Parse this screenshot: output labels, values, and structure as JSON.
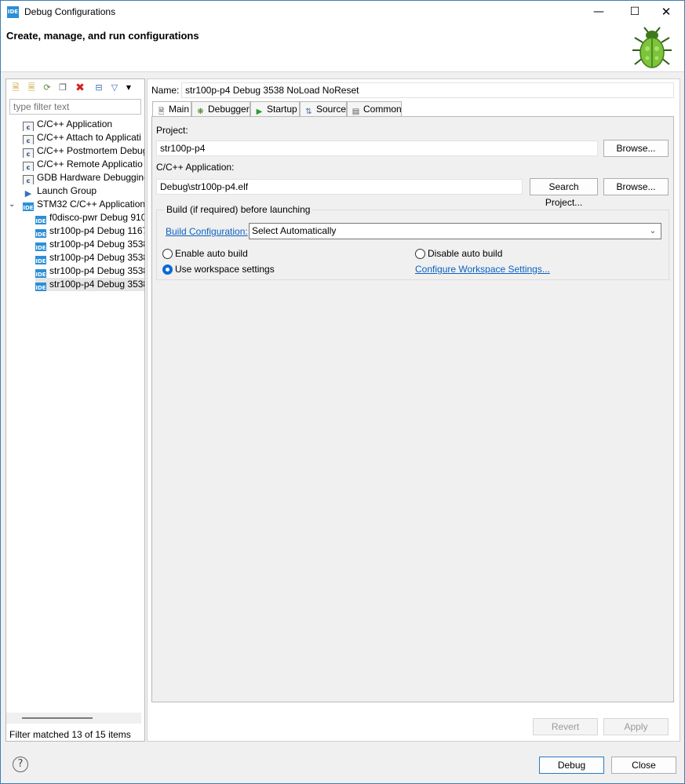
{
  "window": {
    "app_icon": "IDE",
    "title": "Debug Configurations",
    "minimize": "—",
    "maximize": "☐",
    "close": "✕"
  },
  "header": {
    "title": "Create, manage, and run configurations",
    "logo": "bug-icon"
  },
  "toolbar": {
    "icons": [
      "new-configuration-icon",
      "new-prototype-icon",
      "export-icon",
      "duplicate-icon",
      "delete-icon",
      "collapse-all-icon",
      "filter-icon",
      "dropdown-icon"
    ]
  },
  "filter": {
    "placeholder": "type filter text",
    "status": "Filter matched 13 of 15 items"
  },
  "tree": {
    "items": [
      {
        "label": "C/C++ Application",
        "icon": "c-icon"
      },
      {
        "label": "C/C++ Attach to Applicati",
        "icon": "c-icon"
      },
      {
        "label": "C/C++ Postmortem Debug",
        "icon": "c-icon"
      },
      {
        "label": "C/C++ Remote Applicatio",
        "icon": "c-icon"
      },
      {
        "label": "GDB Hardware Debugging",
        "icon": "c-icon"
      },
      {
        "label": "Launch Group",
        "icon": "launch-group-icon"
      },
      {
        "label": "STM32 C/C++ Application",
        "icon": "ide-icon",
        "expanded": true
      },
      {
        "label": "f0disco-pwr Debug 910",
        "icon": "ide-icon"
      },
      {
        "label": "str100p-p4 Debug 1167",
        "icon": "ide-icon"
      },
      {
        "label": "str100p-p4 Debug 3538",
        "icon": "ide-icon"
      },
      {
        "label": "str100p-p4 Debug 3538",
        "icon": "ide-icon"
      },
      {
        "label": "str100p-p4 Debug 3538",
        "icon": "ide-icon"
      },
      {
        "label": "str100p-p4 Debug 3538",
        "icon": "ide-icon",
        "selected": true
      }
    ],
    "icon_text": "IDE",
    "c_icon_text": "c"
  },
  "config": {
    "name_label": "Name:",
    "name_value": "str100p-p4 Debug 3538 NoLoad NoReset",
    "tabs": [
      {
        "label": "Main",
        "icon": "main-tab-icon"
      },
      {
        "label": "Debugger",
        "icon": "debugger-tab-icon"
      },
      {
        "label": "Startup",
        "icon": "startup-tab-icon"
      },
      {
        "label": "Source",
        "icon": "source-tab-icon"
      },
      {
        "label": "Common",
        "icon": "common-tab-icon"
      }
    ],
    "project_label": "Project:",
    "project_value": "str100p-p4",
    "browse_label": "Browse...",
    "application_label": "C/C++ Application:",
    "application_value": "Debug\\str100p-p4.elf",
    "search_project_label": "Search Project...",
    "build_group_title": "Build (if required) before launching",
    "build_config_label": "Build Configuration:",
    "build_config_value": "Select Automatically",
    "enable_auto_build": "Enable auto build",
    "disable_auto_build": "Disable auto build",
    "use_workspace_settings": "Use workspace settings",
    "configure_workspace_link": "Configure Workspace Settings...",
    "selected_build_option": "use_workspace_settings"
  },
  "actions": {
    "revert": "Revert",
    "apply": "Apply",
    "debug": "Debug",
    "close": "Close",
    "help": "?"
  },
  "colors": {
    "accent": "#2c8fd6",
    "link": "#0a62c0",
    "delete": "#d42020"
  }
}
